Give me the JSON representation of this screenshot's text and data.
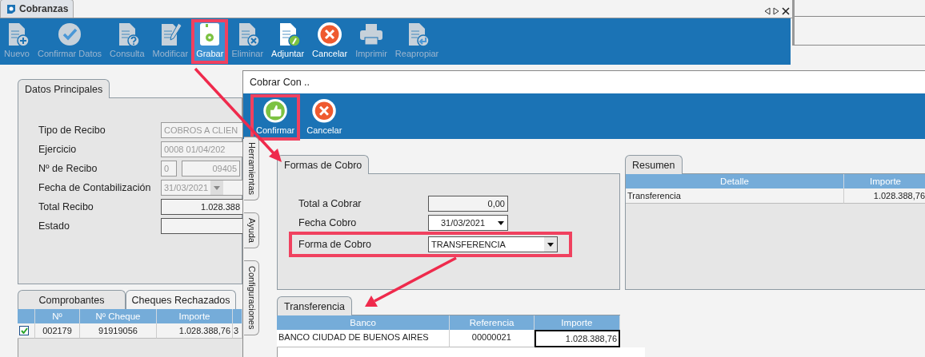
{
  "window": {
    "tab": "Cobranzas"
  },
  "toolbar": [
    {
      "label": "Nuevo",
      "kind": "new",
      "disabled": true,
      "selected": false,
      "highlighted": false
    },
    {
      "label": "Confirmar Datos",
      "kind": "confirm",
      "disabled": true,
      "selected": false,
      "highlighted": false
    },
    {
      "label": "Consulta",
      "kind": "query",
      "disabled": true,
      "selected": false,
      "highlighted": false
    },
    {
      "label": "Modificar",
      "kind": "edit",
      "disabled": true,
      "selected": false,
      "highlighted": false
    },
    {
      "label": "Grabar",
      "kind": "save",
      "disabled": false,
      "selected": true,
      "highlighted": true
    },
    {
      "label": "Eliminar",
      "kind": "delete",
      "disabled": true,
      "selected": false,
      "highlighted": false
    },
    {
      "label": "Adjuntar",
      "kind": "attach",
      "disabled": false,
      "selected": false,
      "highlighted": false
    },
    {
      "label": "Cancelar",
      "kind": "cancel",
      "disabled": false,
      "selected": false,
      "highlighted": false
    },
    {
      "label": "Imprimir",
      "kind": "print",
      "disabled": true,
      "selected": false,
      "highlighted": false
    },
    {
      "label": "Reapropiar",
      "kind": "reassign",
      "disabled": true,
      "selected": false,
      "highlighted": false
    }
  ],
  "datos_principales": {
    "tab": "Datos Principales",
    "fields": [
      {
        "label": "Tipo de Recibo",
        "kind": "text",
        "values": [
          "COBROS A CLIEN"
        ],
        "disabled": true
      },
      {
        "label": "Ejercicio",
        "kind": "text",
        "values": [
          "0008 01/04/202"
        ],
        "disabled": true
      },
      {
        "label": "Nº de Recibo",
        "kind": "pair",
        "values": [
          "0",
          "09405"
        ],
        "disabled": true
      },
      {
        "label": "Fecha de Contabilización",
        "kind": "date",
        "values": [
          "31/03/2021"
        ],
        "disabled": true
      },
      {
        "label": "Total Recibo",
        "kind": "number",
        "values": [
          "1.028.388"
        ],
        "disabled": false
      },
      {
        "label": "Estado",
        "kind": "text",
        "disabled": false
      }
    ]
  },
  "bottom_tabs": [
    {
      "label": "Comprobantes",
      "selected": false
    },
    {
      "label": "Cheques Rechazados",
      "selected": true
    }
  ],
  "cheques_table": {
    "columns": [
      "Nº",
      "Nº Cheque",
      "Importe"
    ],
    "rows": [
      {
        "checked": true,
        "cells": [
          "002179",
          "91919056",
          "1.028.388,76",
          "3"
        ]
      }
    ]
  },
  "side_tabs": [
    "Herramientas",
    "Ayuda",
    "Configuraciones"
  ],
  "dialog": {
    "title": "Cobrar Con ..",
    "toolbar": [
      {
        "label": "Confirmar",
        "kind": "thumb",
        "highlighted": true
      },
      {
        "label": "Cancelar",
        "kind": "cancel",
        "highlighted": false
      }
    ],
    "formas": {
      "tab": "Formas de Cobro",
      "fields": [
        {
          "label": "Total a Cobrar",
          "kind": "number",
          "value": "0,00",
          "highlighted": false
        },
        {
          "label": "Fecha Cobro",
          "kind": "date",
          "value": "31/03/2021",
          "highlighted": false
        },
        {
          "label": "Forma de Cobro",
          "kind": "select",
          "value": "TRANSFERENCIA",
          "highlighted": true
        }
      ]
    },
    "resumen": {
      "tab": "Resumen",
      "columns": [
        "Detalle",
        "Importe"
      ],
      "rows": [
        [
          "Transferencia",
          "1.028.388,76"
        ]
      ]
    },
    "transferencia": {
      "tab": "Transferencia",
      "columns": [
        "Banco",
        "Referencia",
        "Importe"
      ],
      "rows": [
        [
          "BANCO CIUDAD DE BUENOS AIRES",
          "00000021",
          "1.028.388,76"
        ]
      ]
    }
  }
}
